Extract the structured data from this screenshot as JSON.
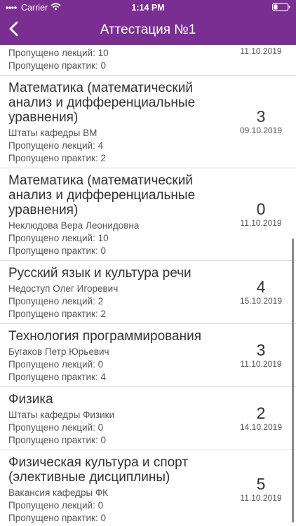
{
  "status_bar": {
    "carrier": "Carrier",
    "time": "1:14 PM"
  },
  "nav": {
    "title": "Аттестация №1"
  },
  "rows": [
    {
      "lines": [
        "Пропущено лекций: 10",
        "Пропущено практик: 0"
      ],
      "date": "11.10.2019"
    },
    {
      "title": "Математика (математический анализ и дифференциальные уравнения)",
      "lines": [
        "Штаты кафедры ВМ",
        "Пропущено лекций: 4",
        "Пропущено практик: 2"
      ],
      "grade": "3",
      "date": "09.10.2019"
    },
    {
      "title": "Математика (математический анализ и дифференциальные уравнения)",
      "lines": [
        "Неклюдова Вера Леонидовна",
        "Пропущено лекций: 10",
        "Пропущено практик: 0"
      ],
      "grade": "0",
      "date": "11.10.2019"
    },
    {
      "title": "Русский язык и культура речи",
      "lines": [
        "Недоступ Олег Игоревич",
        "Пропущено лекций: 2",
        "Пропущено практик: 2"
      ],
      "grade": "4",
      "date": "15.10.2019"
    },
    {
      "title": "Технология программирования",
      "lines": [
        "Бугаков Петр Юрьевич",
        "Пропущено лекций: 0",
        "Пропущено практик: 4"
      ],
      "grade": "3",
      "date": "11.10.2019"
    },
    {
      "title": "Физика",
      "lines": [
        "Штаты кафедры Физики",
        "Пропущено лекций: 0",
        "Пропущено практик: 0"
      ],
      "grade": "2",
      "date": "14.10.2019"
    },
    {
      "title": "Физическая культура и спорт (элективные дисциплины)",
      "lines": [
        "Вакансия кафедры ФК",
        "Пропущено лекций: 0",
        "Пропущено практик: 0"
      ],
      "grade": "5",
      "date": "11.10.2019"
    }
  ]
}
